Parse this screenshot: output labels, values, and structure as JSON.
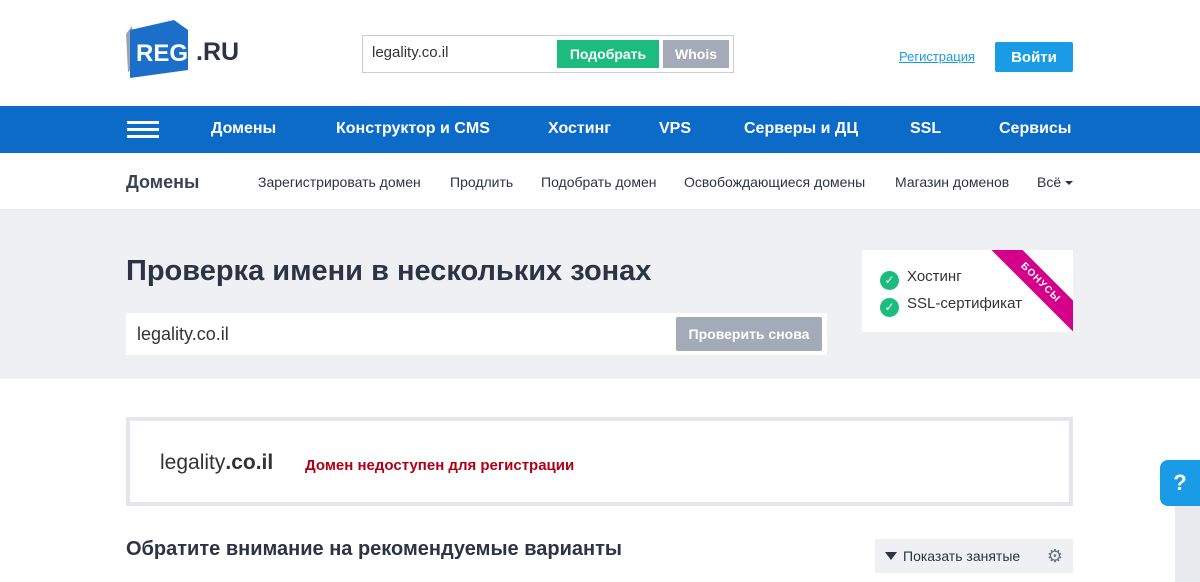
{
  "header": {
    "logo_reg": "REG",
    "logo_ru": ".RU",
    "search_value": "legality.co.il",
    "pick_label": "Подобрать",
    "whois_label": "Whois",
    "register_link": "Регистрация",
    "login_label": "Войти"
  },
  "mainnav": {
    "items": [
      "Домены",
      "Конструктор и CMS",
      "Хостинг",
      "VPS",
      "Серверы и ДЦ",
      "SSL",
      "Сервисы"
    ]
  },
  "subnav": {
    "title": "Домены",
    "links": [
      "Зарегистрировать домен",
      "Продлить",
      "Подобрать домен",
      "Освобождающиеся домены",
      "Магазин доменов",
      "Всё"
    ]
  },
  "hero": {
    "heading": "Проверка имени в нескольких зонах",
    "input_value": "legality.co.il",
    "recheck_label": "Проверить снова"
  },
  "bonus": {
    "items": [
      "Хостинг",
      "SSL-сертификат"
    ],
    "ribbon": "БОНУСЫ"
  },
  "result": {
    "domain_name": "legality",
    "domain_zone": ".co.il",
    "status": "Домен недоступен для регистрации"
  },
  "recommend": {
    "title": "Обратите внимание на рекомендуемые варианты",
    "show_taken_label": "Показать занятые"
  },
  "help": {
    "label": "?"
  },
  "colors": {
    "brand_blue": "#0c6ac9",
    "accent_blue": "#1a9be6",
    "green": "#1bbc7d",
    "error_red": "#b00017",
    "ribbon_magenta": "#d4008a"
  }
}
